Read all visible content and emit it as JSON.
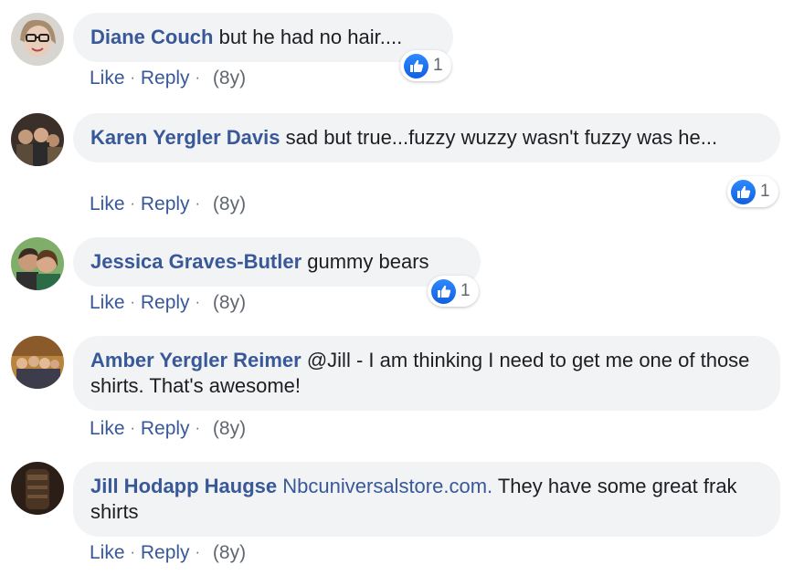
{
  "comments": [
    {
      "author": "Diane Couch",
      "text": " but he had no hair....",
      "like_label": "Like",
      "reply_label": "Reply",
      "age": "(8y)",
      "reaction_count": "1"
    },
    {
      "author": "Karen Yergler Davis",
      "text": " sad but true...fuzzy wuzzy wasn't fuzzy was he...",
      "like_label": "Like",
      "reply_label": "Reply",
      "age": "(8y)",
      "reaction_count": "1"
    },
    {
      "author": "Jessica Graves-Butler",
      "text": " gummy bears",
      "like_label": "Like",
      "reply_label": "Reply",
      "age": "(8y)",
      "reaction_count": "1"
    },
    {
      "author": "Amber Yergler Reimer",
      "text": " @Jill - I am thinking I need to get me one of those shirts. That's awesome!",
      "like_label": "Like",
      "reply_label": "Reply",
      "age": "(8y)"
    },
    {
      "author": "Jill Hodapp Haugse",
      "link_text": "Nbcuniversalstore.com.",
      "text": " They have some great frak shirts",
      "like_label": "Like",
      "reply_label": "Reply",
      "age": "(8y)"
    }
  ],
  "separator": "·",
  "colors": {
    "author": "#385898",
    "bubble_bg": "#f2f3f5",
    "like_badge": "#1877f2",
    "meta": "#606770"
  }
}
